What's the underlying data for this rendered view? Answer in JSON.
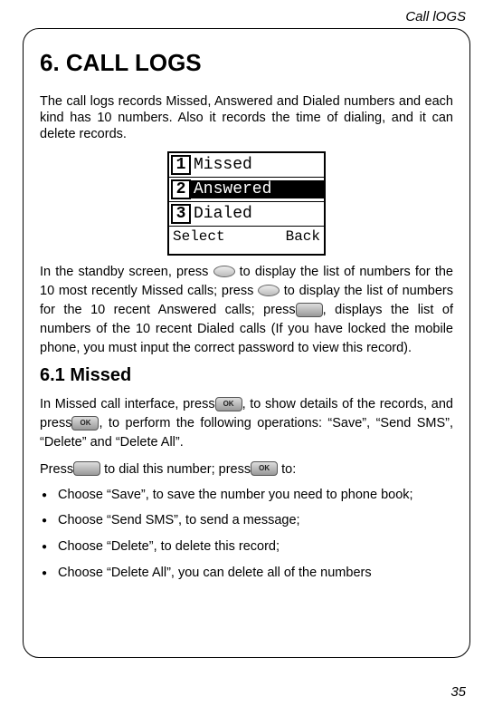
{
  "header": "Call lOGS",
  "title": "6. CALL LOGS",
  "intro": "The call logs records Missed, Answered and Dialed numbers and each kind has 10 numbers. Also it records the time of dialing, and it can delete records.",
  "screen": {
    "rows": [
      {
        "num": "1",
        "label": "Missed",
        "selected": false
      },
      {
        "num": "2",
        "label": "Answered",
        "selected": true
      },
      {
        "num": "3",
        "label": "Dialed",
        "selected": false
      }
    ],
    "softLeft": "Select",
    "softRight": "Back"
  },
  "para1": {
    "seg1": "In the standby screen, press ",
    "seg2": " to display the list of numbers for the 10 most recently Missed calls; press ",
    "seg3": " to display the list of numbers for the 10 recent Answered calls; press",
    "seg4": ", displays the list of numbers of the 10 recent Dialed calls (If you have locked the mobile phone, you must input the correct password to view this record)."
  },
  "section1": "6.1 Missed",
  "para2": {
    "seg1": "In Missed call interface, press",
    "seg2": ", to show details of the records, and press",
    "seg3": ", to perform the following operations: “Save”, “Send SMS”, “Delete” and “Delete All”."
  },
  "para3": {
    "seg1": "Press",
    "seg2": " to dial this number; press",
    "seg3": " to:"
  },
  "bullets": [
    "Choose “Save”, to save the number you need to phone book;",
    "Choose “Send SMS”, to send a message;",
    "Choose “Delete”, to delete this record;",
    "Choose “Delete All”, you can delete all of the numbers"
  ],
  "pageNum": "35",
  "okLabel": "OK"
}
